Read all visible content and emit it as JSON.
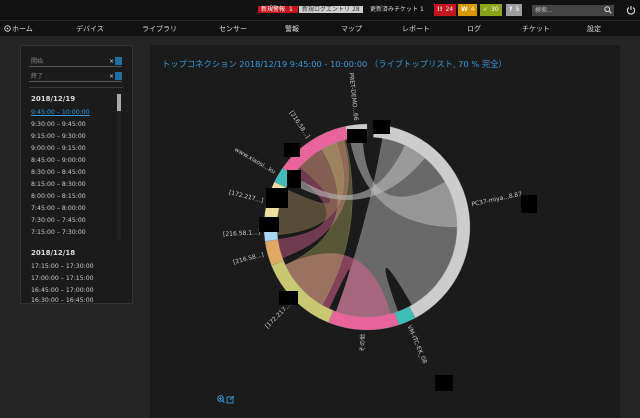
{
  "topbar": {
    "new_alert_label": "新規警報",
    "new_alert_count": "1",
    "new_log_label": "新規ログエントリ",
    "new_log_count": "28",
    "tickets_label": "更新済みチケット",
    "tickets_count": "1",
    "chips": [
      {
        "icon": "!!",
        "value": "24",
        "color": "#c4161c"
      },
      {
        "icon": "W",
        "value": "4",
        "color": "#d89a00"
      },
      {
        "icon": "✓",
        "value": "30",
        "color": "#8aa51a"
      },
      {
        "icon": "?",
        "value": "5",
        "color": "#9e9e9e"
      }
    ],
    "search_placeholder": "検索..."
  },
  "nav": {
    "home": "ホーム",
    "items": [
      "デバイス",
      "ライブラリ",
      "センサー",
      "警報",
      "マップ",
      "レポート",
      "ログ",
      "チケット",
      "設定"
    ]
  },
  "filter": {
    "start_placeholder": "開始",
    "end_placeholder": "終了",
    "clear_symbol": "×"
  },
  "days": [
    {
      "date": "2018/12/19",
      "slots": [
        "9:45:00 – 10:00:00",
        "9:30:00 – 9:45:00",
        "9:15:00 – 9:30:00",
        "9:00:00 – 9:15:00",
        "8:45:00 – 9:00:00",
        "8:30:00 – 8:45:00",
        "8:15:00 – 8:30:00",
        "8:00:00 – 8:15:00",
        "7:45:00 – 8:00:00",
        "7:30:00 – 7:45:00",
        "7:15:00 – 7:30:00"
      ]
    },
    {
      "date": "2018/12/18",
      "slots": [
        "17:15:00 – 17:30:00",
        "17:00:00 – 17:15:00",
        "16:45:00 – 17:00:00",
        "16:30:00 – 16:45:00"
      ]
    }
  ],
  "main": {
    "title": "トップコネクション 2018/12/19 9:45:00 - 10:00:00 （ライブトップリスト, 70 % 完全）"
  },
  "chord_data": {
    "type": "chord",
    "groups": [
      {
        "label": "PC37-miya...8.87",
        "color": "#cccccc"
      },
      {
        "label": "VM-ITC-EK_08",
        "color": "#3bbfb8"
      },
      {
        "label": "その他",
        "color": "#e8649a"
      },
      {
        "label": "[172.217...]",
        "color": "#c8c870"
      },
      {
        "label": "[216.58...]",
        "color": "#e0a860"
      },
      {
        "label": "[216.58.1...]",
        "color": "#a8d8f0"
      },
      {
        "label": "[172.217...]",
        "color": "#f0e0a0"
      },
      {
        "label": "www.xiaosi...ku",
        "color": "#3bbfb8"
      },
      {
        "label": "[216.58...]",
        "color": "#e8649a"
      },
      {
        "label": "PRET-DEMO...66",
        "color": "#cccccc"
      }
    ]
  },
  "colors": {
    "accent": "#3a9ad9",
    "alert_red": "#c4161c"
  }
}
